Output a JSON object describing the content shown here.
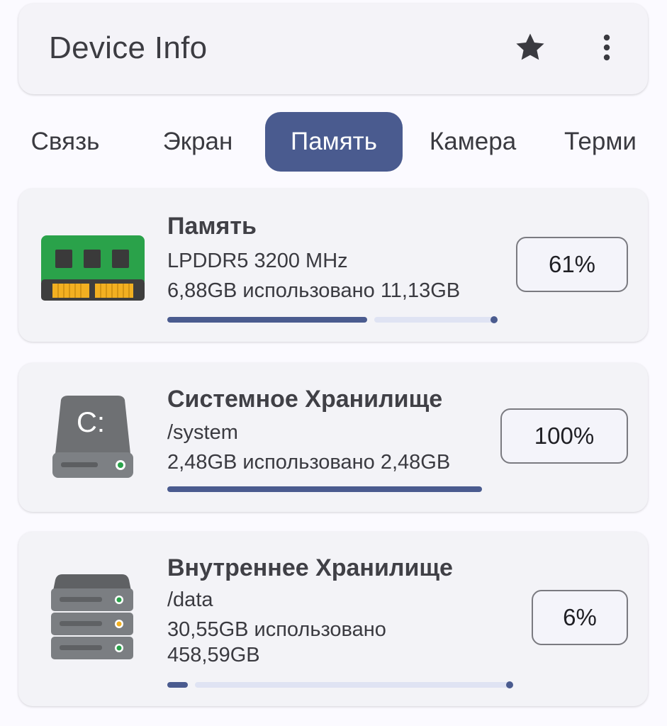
{
  "app": {
    "title": "Device Info",
    "actions": [
      {
        "icon": "star-icon"
      },
      {
        "icon": "more-vert-icon"
      }
    ]
  },
  "tabs": [
    {
      "label": "Связь",
      "active": false
    },
    {
      "label": "Экран",
      "active": false
    },
    {
      "label": "Память",
      "active": true
    },
    {
      "label": "Камера",
      "active": false
    },
    {
      "label": "Терми",
      "active": false
    }
  ],
  "cards": [
    {
      "icon": "ram-chip-icon",
      "title": "Память",
      "subtitle": "LPDDR5 3200 MHz",
      "usage": "6,88GB использовано 11,13GB",
      "percent_label": "61%",
      "progress": 0.61
    },
    {
      "icon": "system-drive-icon",
      "drive_letter": "C:",
      "title": "Системное Хранилище",
      "subtitle": "/system",
      "usage": "2,48GB использовано 2,48GB",
      "percent_label": "100%",
      "progress": 1.0
    },
    {
      "icon": "server-storage-icon",
      "title": "Внутреннее Хранилище",
      "subtitle": "/data",
      "usage": "30,55GB использовано",
      "usage_total": "458,59GB",
      "percent_label": "6%",
      "progress": 0.06
    }
  ],
  "colors": {
    "accent": "#4a5b8f",
    "track": "#dfe3f3",
    "card": "#f3f3f7",
    "background": "#fbfaff"
  }
}
